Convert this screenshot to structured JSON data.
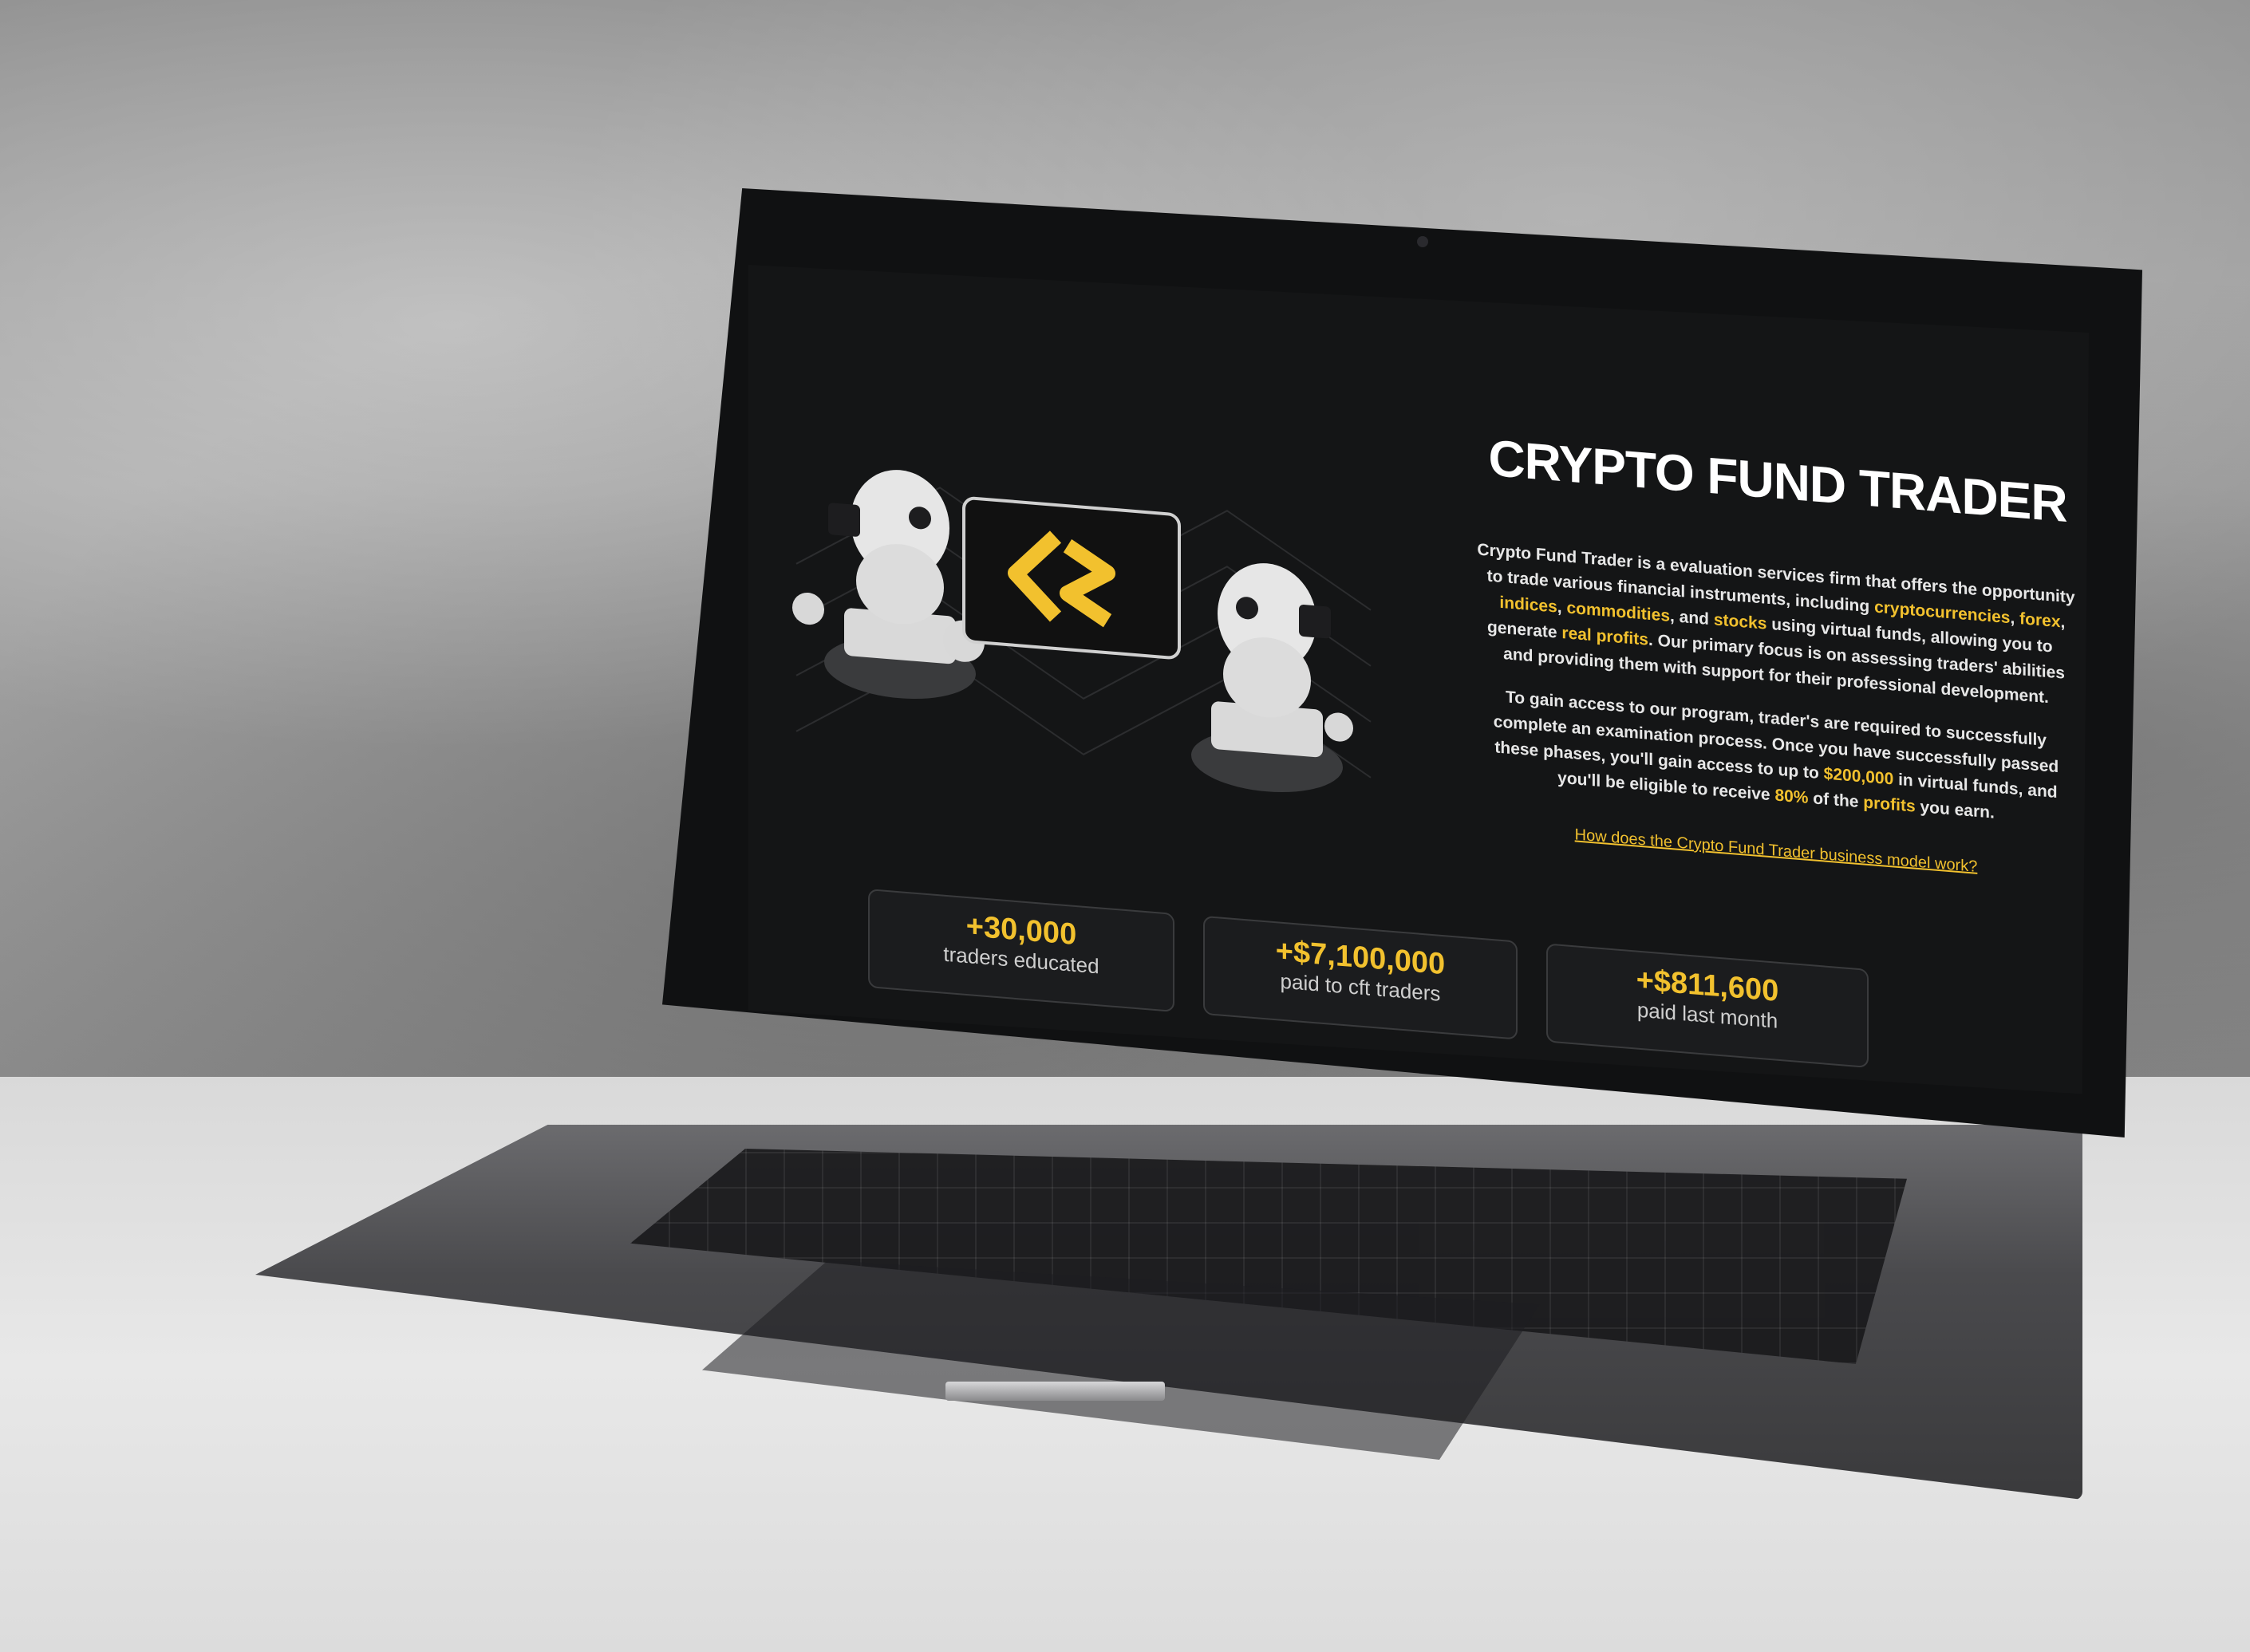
{
  "site": {
    "title": "CRYPTO FUND TRADER",
    "description": [
      [
        {
          "t": "Crypto Fund Trader is a evaluation services firm that offers the opportunity to trade various financial instruments, including ",
          "hl": false
        },
        {
          "t": "cryptocurrencies",
          "hl": true
        },
        {
          "t": ", ",
          "hl": false
        },
        {
          "t": "forex",
          "hl": true
        },
        {
          "t": ", ",
          "hl": false
        },
        {
          "t": "indices",
          "hl": true
        },
        {
          "t": ", ",
          "hl": false
        },
        {
          "t": "commodities",
          "hl": true
        },
        {
          "t": ", and ",
          "hl": false
        },
        {
          "t": "stocks",
          "hl": true
        },
        {
          "t": " using virtual funds, allowing you to generate ",
          "hl": false
        },
        {
          "t": "real profits",
          "hl": true
        },
        {
          "t": ". Our primary focus is on assessing traders' abilities and providing them with support for their professional development.",
          "hl": false
        }
      ],
      [
        {
          "t": "To gain access to our program, trader's are required to successfully complete an examination process. Once you have successfully passed these phases, you'll gain access to up to ",
          "hl": false
        },
        {
          "t": "$200,000",
          "hl": true
        },
        {
          "t": " in virtual funds, and you'll be eligible to receive ",
          "hl": false
        },
        {
          "t": "80%",
          "hl": true
        },
        {
          "t": " of the ",
          "hl": false
        },
        {
          "t": "profits",
          "hl": true
        },
        {
          "t": " you earn.",
          "hl": false
        }
      ]
    ],
    "link": "How does the Crypto Fund Trader business model work?",
    "stats": [
      {
        "value": "+30,000",
        "label": "traders educated"
      },
      {
        "value": "+$7,100,000",
        "label": "paid to cft traders"
      },
      {
        "value": "+$811,600",
        "label": "paid last month"
      }
    ]
  },
  "colors": {
    "accent": "#f2c12e",
    "background": "#141516",
    "text": "#ffffff"
  },
  "icons": [
    "robot-icon",
    "crypto-fund-trader-logo-icon"
  ]
}
